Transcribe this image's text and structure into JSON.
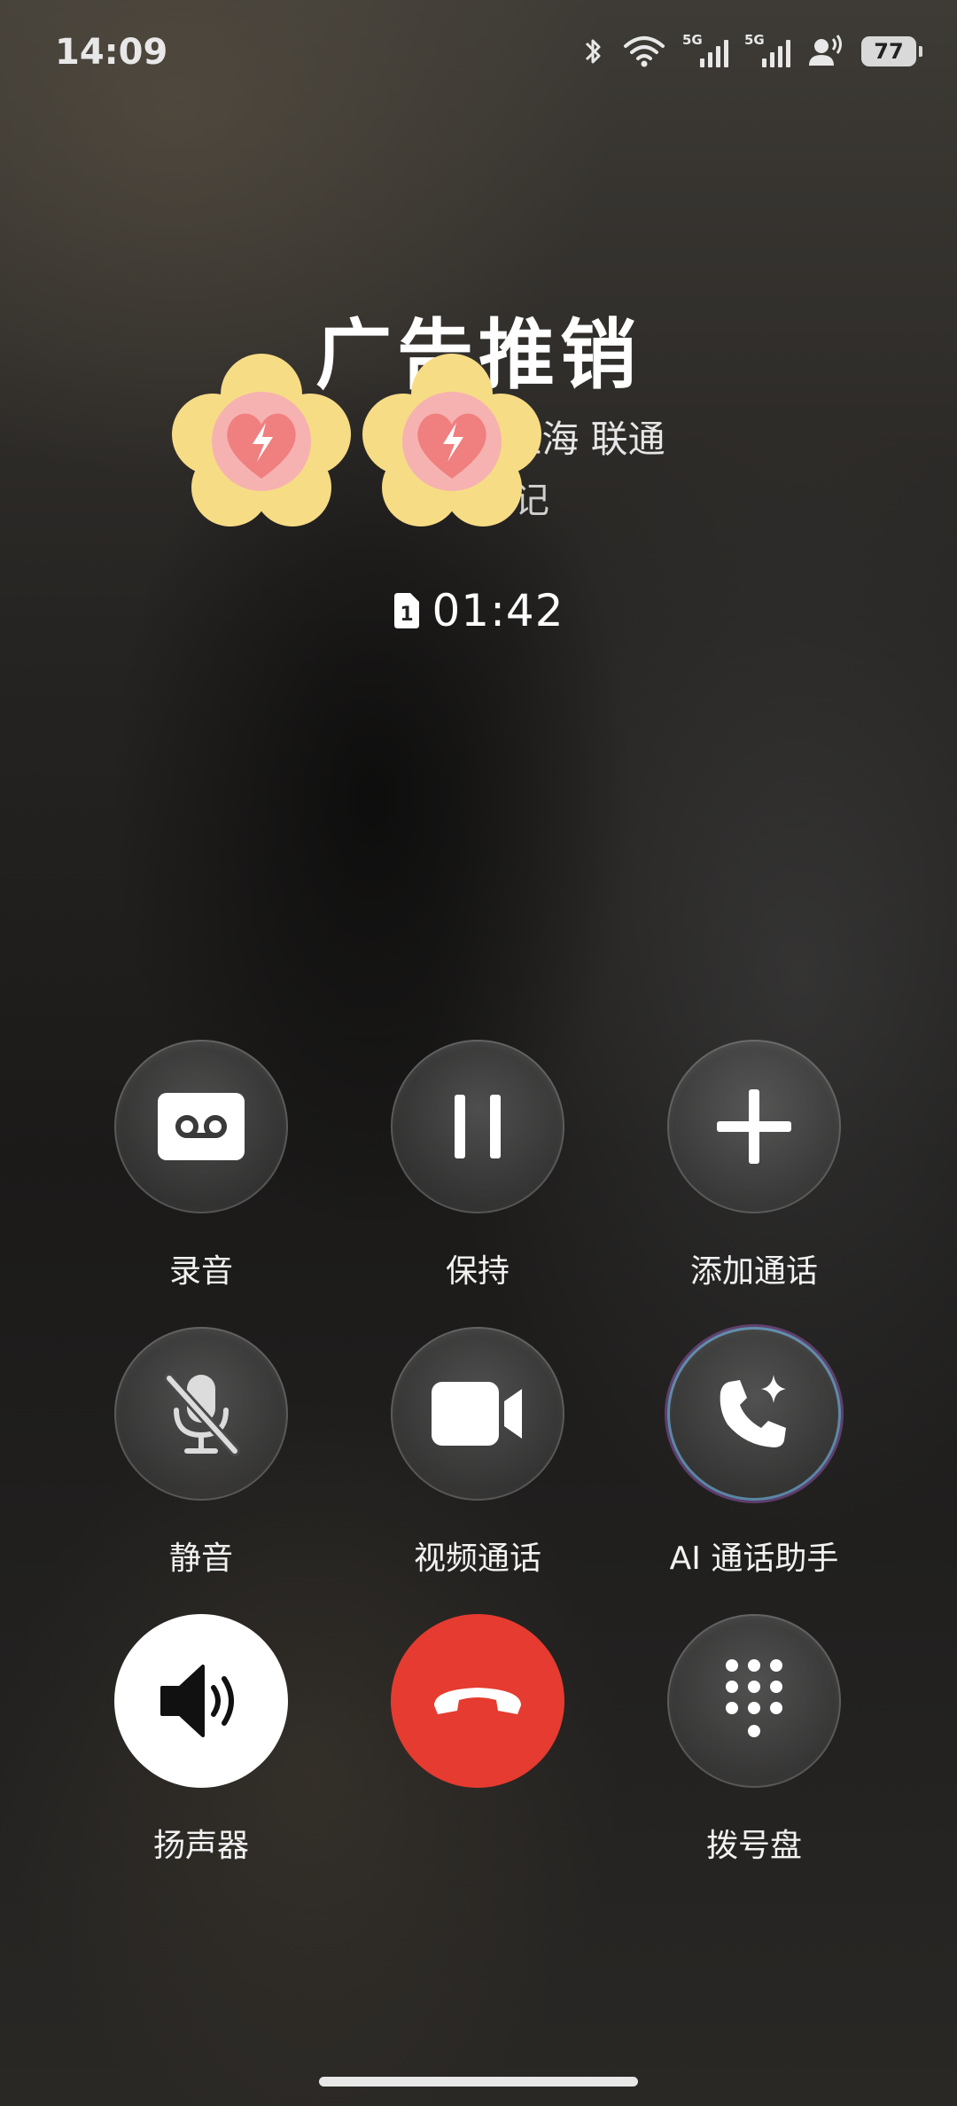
{
  "status_bar": {
    "time": "14:09",
    "network_label_1": "5G",
    "network_label_2": "5G",
    "battery": "77"
  },
  "caller": {
    "name": "广告推销",
    "location_carrier": "上海 联通",
    "note": "记"
  },
  "call": {
    "sim_slot": "1",
    "duration": "01:42"
  },
  "controls": {
    "record": "录音",
    "hold": "保持",
    "add_call": "添加通话",
    "mute": "静音",
    "video_call": "视频通话",
    "ai_assistant": "AI 通话助手",
    "speaker": "扬声器",
    "end_call": "",
    "dialpad": "拨号盘"
  },
  "colors": {
    "end_call": "#e63b30",
    "speaker_active": "#ffffff",
    "sticker_petal": "#f7dc86",
    "sticker_heart": "#f08080"
  },
  "icons": [
    "bluetooth-icon",
    "wifi-icon",
    "signal-icon",
    "hotspot-icon",
    "battery-icon",
    "sim-icon",
    "voicemail-icon",
    "pause-icon",
    "plus-icon",
    "mic-off-icon",
    "video-camera-icon",
    "phone-sparkle-icon",
    "speaker-icon",
    "hangup-icon",
    "dialpad-icon"
  ]
}
